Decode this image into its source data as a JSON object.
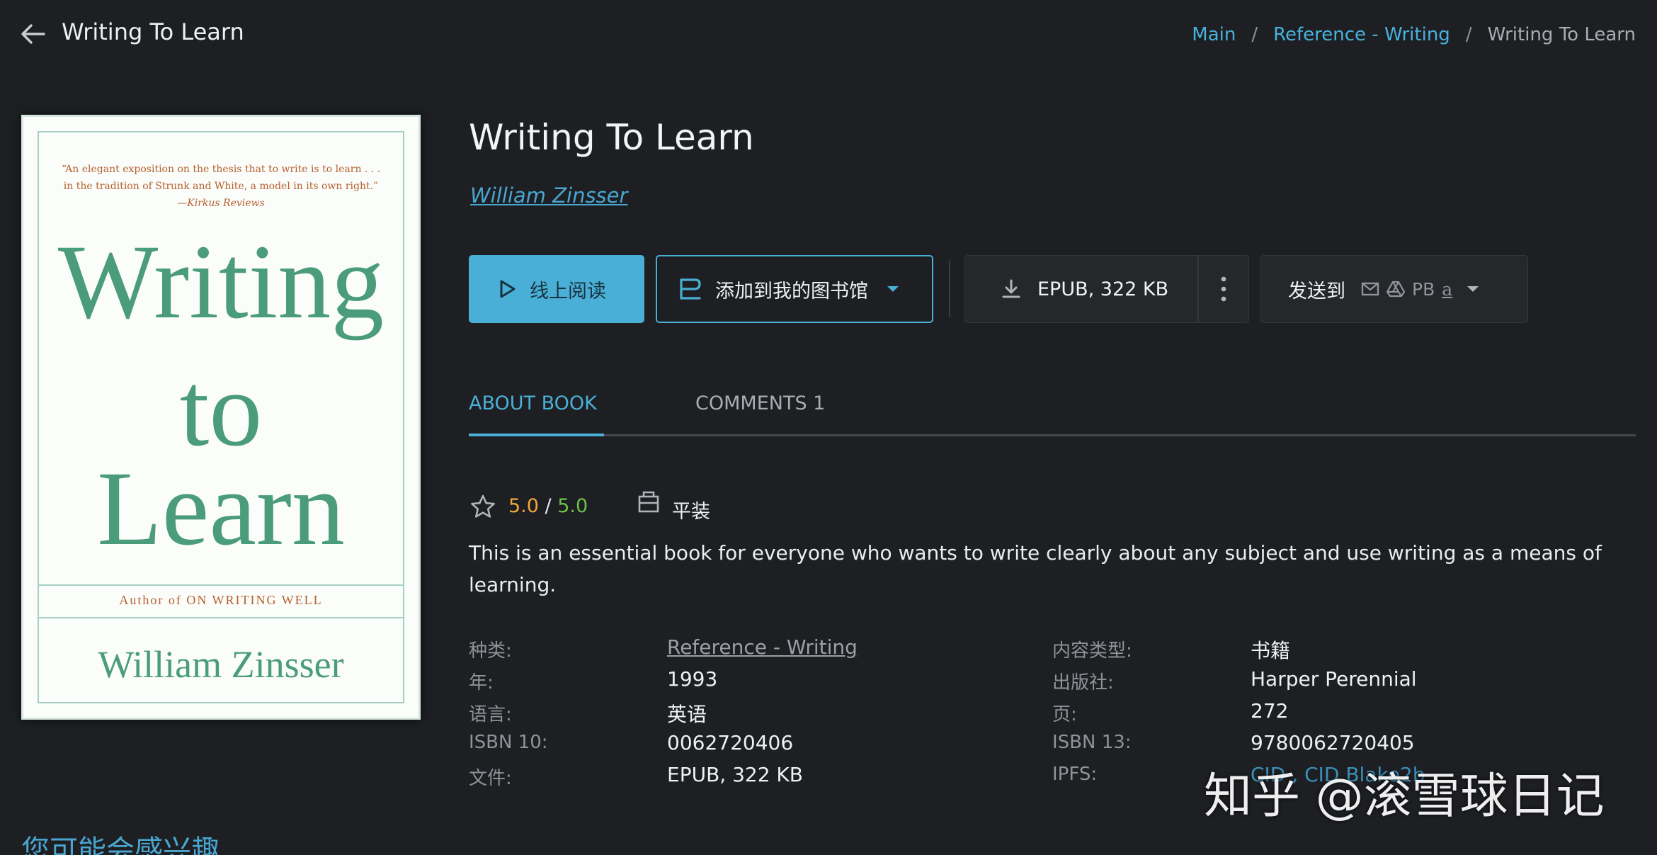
{
  "header": {
    "title": "Writing To Learn",
    "breadcrumbs": [
      {
        "label": "Main"
      },
      {
        "label": "Reference - Writing"
      },
      {
        "label": "Writing To Learn"
      }
    ]
  },
  "cover": {
    "quote_line1": "“An elegant exposition on the thesis that to write is to learn . . .",
    "quote_line2": "in the tradition of Strunk and White, a model in its own right.”",
    "quote_line3": "—Kirkus Reviews",
    "title_line1": "Writing",
    "title_line2": "to",
    "title_line3": "Learn",
    "author_of": "Author of ON WRITING WELL",
    "author": "William Zinsser"
  },
  "book": {
    "title": "Writing To Learn",
    "author": "William Zinsser"
  },
  "actions": {
    "read_online": "线上阅读",
    "add_to_library": "添加到我的图书馆",
    "download": "EPUB, 322 KB",
    "send_to": "发送到",
    "send_targets": {
      "pb": "PB",
      "amazon": "a"
    }
  },
  "tabs": {
    "about": "ABOUT BOOK",
    "comments": "COMMENTS 1"
  },
  "rating": {
    "score": "5.0",
    "separator": "/",
    "max": "5.0",
    "binding": "平装"
  },
  "description": "This is an essential book for everyone who wants to write clearly about any subject and use writing as a means of learning.",
  "details_left": [
    {
      "label": "种类:",
      "value": "Reference - Writing"
    },
    {
      "label": "年:",
      "value": "1993"
    },
    {
      "label": "语言:",
      "value": "英语"
    },
    {
      "label": "ISBN 10:",
      "value": "0062720406"
    },
    {
      "label": "文件:",
      "value": "EPUB, 322 KB"
    }
  ],
  "details_right": [
    {
      "label": "内容类型:",
      "value": "书籍"
    },
    {
      "label": "出版社:",
      "value": "Harper Perennial"
    },
    {
      "label": "页:",
      "value": "272"
    },
    {
      "label": "ISBN 13:",
      "value": "9780062720405"
    },
    {
      "label": "IPFS:",
      "value": "CID , CID Blake2b"
    }
  ],
  "suggestions_heading": "您可能会感兴趣",
  "watermark": "知乎 @滚雪球日记",
  "colors": {
    "background": "#1d1f23",
    "accent": "#4aafd6",
    "rating_score": "#f2a93b",
    "rating_max": "#6cc24a"
  }
}
